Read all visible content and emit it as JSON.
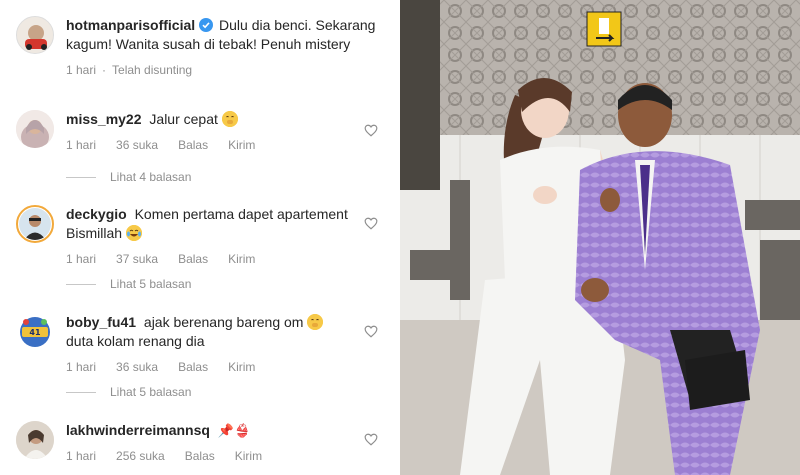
{
  "caption": {
    "username": "hotmanparisofficial",
    "text": "Dulu dia benci. Sekarang kagum! Wanita susah di tebak! Penuh mistery",
    "time": "1 hari",
    "edited": "Telah disunting"
  },
  "comments": [
    {
      "username": "miss_my22",
      "text": "Jalur cepat",
      "emoji_icon": "hand-over-mouth-emoji",
      "time": "1 hari",
      "likes": "36 suka",
      "reply_label": "Balas",
      "send_label": "Kirim",
      "view_replies": "Lihat 4 balasan"
    },
    {
      "username": "deckygio",
      "text": "Komen pertama dapet apartement Bismillah",
      "emoji_icon": "tears-of-joy-emoji",
      "time": "1 hari",
      "likes": "37 suka",
      "reply_label": "Balas",
      "send_label": "Kirim",
      "view_replies": "Lihat 5 balasan"
    },
    {
      "username": "boby_fu41",
      "text": "ajak berenang bareng om",
      "text2": "duta kolam renang dia",
      "emoji_icon": "hand-over-mouth-emoji",
      "time": "1 hari",
      "likes": "36 suka",
      "reply_label": "Balas",
      "send_label": "Kirim",
      "view_replies": "Lihat 5 balasan"
    },
    {
      "username": "lakhwinderreimannsq",
      "text": "📌👙",
      "time": "1 hari",
      "likes": "256 suka",
      "reply_label": "Balas",
      "send_label": "Kirim"
    }
  ],
  "photo": {
    "wall_sign_icon": "exit-sign-icon"
  },
  "colors": {
    "text": "#262626",
    "secondary": "#8e8e8e",
    "verified": "#3897f0",
    "suit": "#9b7fd0"
  }
}
